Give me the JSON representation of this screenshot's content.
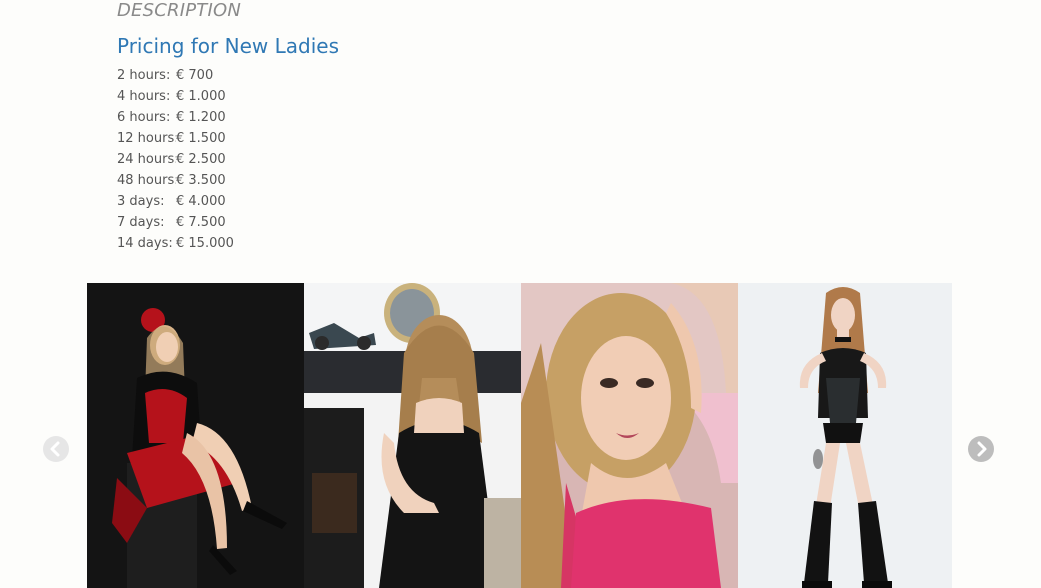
{
  "description": {
    "heading": "DESCRIPTION"
  },
  "pricing": {
    "title": "Pricing for New Ladies",
    "rows": [
      {
        "duration": "2 hours:",
        "price": "€ 700"
      },
      {
        "duration": "4 hours:",
        "price": "€ 1.000"
      },
      {
        "duration": "6 hours:",
        "price": "€ 1.200"
      },
      {
        "duration": "12 hours:",
        "price": "€ 1.500"
      },
      {
        "duration": "24 hours:",
        "price": "€ 2.500"
      },
      {
        "duration": "48 hours:",
        "price": "€ 3.500"
      },
      {
        "duration": "3 days:",
        "price": "€ 4.000"
      },
      {
        "duration": "7 days:",
        "price": "€ 7.500"
      },
      {
        "duration": "14 days:",
        "price": "€ 15.000"
      }
    ]
  },
  "gallery": {
    "photos": [
      {
        "name": "gallery-photo-1",
        "bg": "#141414",
        "accent": "#b5121b"
      },
      {
        "name": "gallery-photo-2",
        "bg": "#e9ecee",
        "accent": "#1a1a1a"
      },
      {
        "name": "gallery-photo-3",
        "bg": "#d8b6b4",
        "accent": "#e0336d"
      },
      {
        "name": "gallery-photo-4",
        "bg": "#eef1f3",
        "accent": "#1c1c1c"
      }
    ],
    "prev_icon": "chevron-left-icon",
    "next_icon": "chevron-right-icon"
  },
  "colors": {
    "accent": "#2f78b4",
    "text": "#555555",
    "muted": "#8a8a8a",
    "background": "#fdfdfb"
  }
}
